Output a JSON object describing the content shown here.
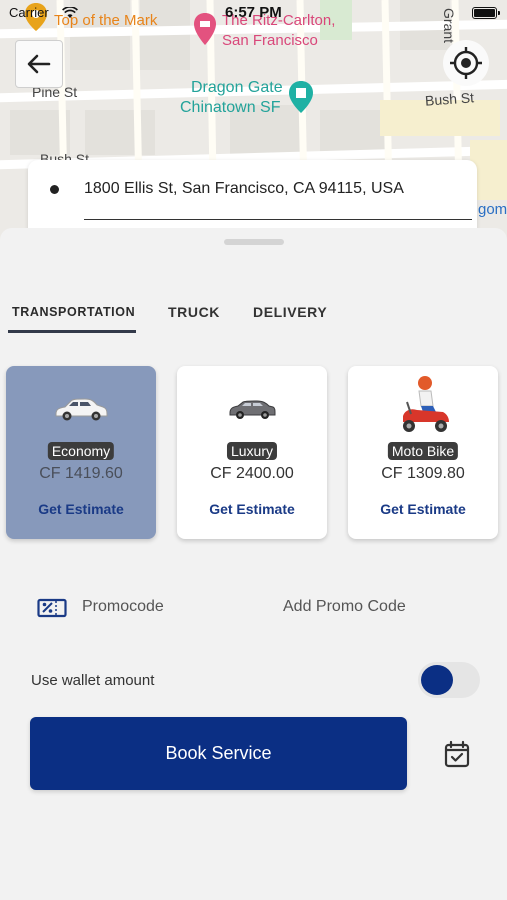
{
  "status_bar": {
    "carrier": "Carrier",
    "time": "6:57 PM"
  },
  "map": {
    "places": {
      "top_of_mark": "Top of the Mark",
      "ritz_line1": "The Ritz-Carlton,",
      "ritz_line2": "San Francisco",
      "dragon_line1": "Dragon Gate",
      "dragon_line2": "Chinatown SF",
      "edge_right": "gom"
    },
    "streets": {
      "pine": "Pine St",
      "bush_right": "Bush St",
      "bush_left": "Bush St",
      "vertical_right": "Grant"
    },
    "colors": {
      "poi_orange": "#e8841a",
      "poi_pink": "#d9477a",
      "poi_teal": "#23a39a"
    }
  },
  "address": {
    "value": "1800 Ellis St, San Francisco, CA 94115, USA"
  },
  "tabs": [
    {
      "label": "TRANSPORTATION",
      "active": true
    },
    {
      "label": "TRUCK",
      "active": false
    },
    {
      "label": "DELIVERY",
      "active": false
    }
  ],
  "vehicles": [
    {
      "name": "Economy",
      "price": "CF 1419.60",
      "action": "Get Estimate",
      "icon": "car-white-icon",
      "selected": true
    },
    {
      "name": "Luxury",
      "price": "CF 2400.00",
      "action": "Get Estimate",
      "icon": "car-dark-icon",
      "selected": false
    },
    {
      "name": "Moto Bike",
      "price": "CF 1309.80",
      "action": "Get Estimate",
      "icon": "scooter-icon",
      "selected": false
    }
  ],
  "promo": {
    "label": "Promocode",
    "action": "Add Promo Code",
    "icon": "discount-icon"
  },
  "wallet": {
    "label": "Use wallet amount",
    "enabled": true
  },
  "book": {
    "label": "Book Service"
  },
  "theme": {
    "primary": "#0b2f84",
    "selected_card": "#8799bb"
  }
}
